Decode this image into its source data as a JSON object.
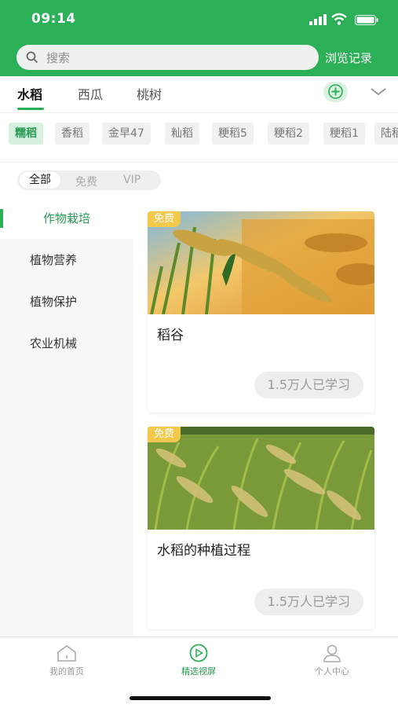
{
  "status": {
    "time": "09:14"
  },
  "search": {
    "placeholder": "搜索",
    "history": "浏览记录"
  },
  "crop_tabs": [
    {
      "label": "水稻",
      "active": true
    },
    {
      "label": "西瓜",
      "active": false
    },
    {
      "label": "桃树",
      "active": false
    }
  ],
  "varieties": [
    "糯稻",
    "香稻",
    "金早47",
    "籼稻",
    "粳稻5",
    "粳稻2",
    "粳稻1",
    "陆稻"
  ],
  "filter": [
    "全部",
    "免费",
    "VIP"
  ],
  "categories": [
    "作物栽培",
    "植物营养",
    "植物保护",
    "农业机械"
  ],
  "cards": [
    {
      "badge": "免费",
      "title": "稻谷",
      "learners": "1.5万人已学习"
    },
    {
      "badge": "免费",
      "title": "水稻的种植过程",
      "learners": "1.5万人已学习"
    }
  ],
  "bottom_nav": [
    {
      "label": "我的首页",
      "icon": "home-icon"
    },
    {
      "label": "精选视屏",
      "icon": "play-icon",
      "active": true
    },
    {
      "label": "个人中心",
      "icon": "user-icon"
    }
  ],
  "colors": {
    "brand": "#2bb057",
    "badge": "#f2c94c"
  }
}
